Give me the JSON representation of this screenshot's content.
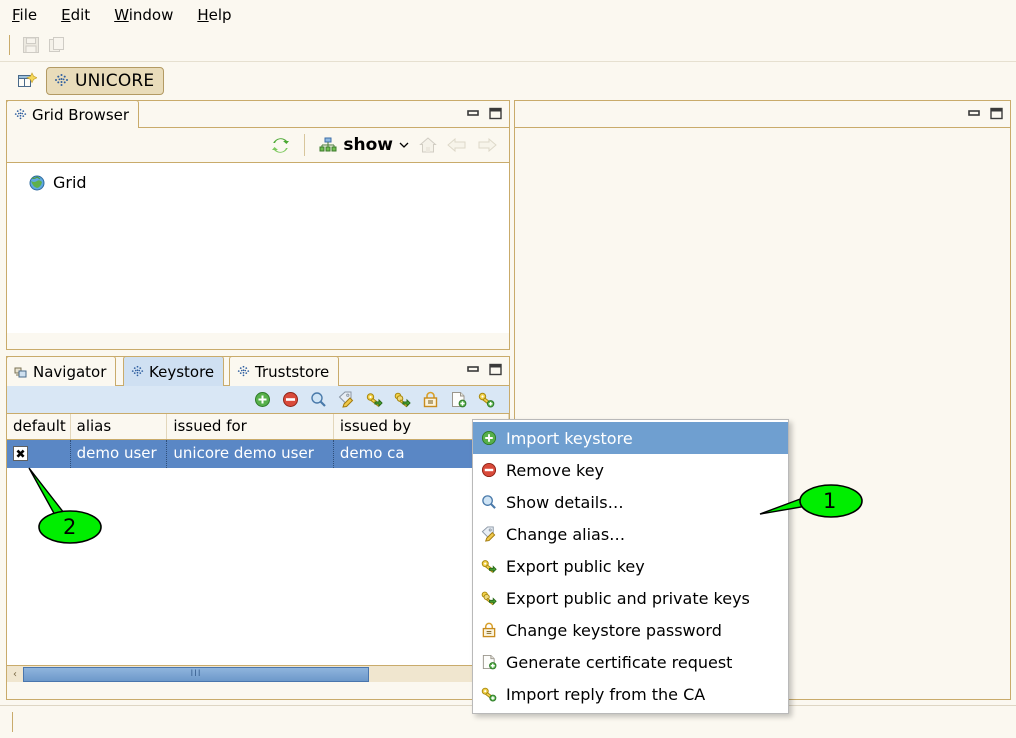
{
  "menubar": {
    "items": [
      {
        "mnemonic": "F",
        "rest": "ile"
      },
      {
        "mnemonic": "E",
        "rest": "dit"
      },
      {
        "mnemonic": "W",
        "rest": "indow"
      },
      {
        "mnemonic": "H",
        "rest": "elp"
      }
    ]
  },
  "toolbar": {
    "buttons": [
      {
        "name": "save-icon",
        "enabled": false
      },
      {
        "name": "copy-icon",
        "enabled": false
      }
    ]
  },
  "perspective": {
    "open_icon": "open-perspective-icon",
    "active_label": "UNICORE",
    "active_icon": "unicore-grid-icon"
  },
  "grid_browser": {
    "tab_label": "Grid Browser",
    "tab_icon": "unicore-grid-icon",
    "toolbar": {
      "refresh_icon": "refresh-icon",
      "show_icon": "hierarchy-icon",
      "show_label": "show",
      "show_chevron": "chevron-down-icon",
      "home_icon": "home-icon",
      "back_icon": "arrow-left-icon",
      "forward_icon": "arrow-right-icon"
    },
    "tree": [
      {
        "label": "Grid",
        "icon": "globe-icon"
      }
    ],
    "view_buttons": [
      "minimize-icon",
      "maximize-icon"
    ]
  },
  "right_panel": {
    "view_buttons": [
      "minimize-icon",
      "maximize-icon"
    ]
  },
  "bottom_view": {
    "tabs": [
      {
        "label": "Navigator",
        "icon": "navigator-icon",
        "active": false
      },
      {
        "label": "Keystore",
        "icon": "unicore-grid-icon",
        "active": true
      },
      {
        "label": "Truststore",
        "icon": "unicore-grid-icon",
        "active": false
      }
    ],
    "view_buttons": [
      "minimize-icon",
      "maximize-icon"
    ],
    "toolbar_icons": [
      "import-keystore-icon",
      "remove-key-icon",
      "show-details-icon",
      "change-alias-icon",
      "export-public-key-icon",
      "export-public-private-keys-icon",
      "change-keystore-password-icon",
      "generate-certificate-request-icon",
      "import-reply-from-ca-icon"
    ],
    "table": {
      "columns": [
        "default",
        "alias",
        "issued for",
        "issued by"
      ],
      "rows": [
        {
          "default_checked": true,
          "alias": "demo user",
          "issued_for": "unicore demo user",
          "issued_by": "demo ca",
          "selected": true
        }
      ]
    },
    "scrollbar": {
      "grip": "III",
      "left_arrow": "‹"
    }
  },
  "context_menu": {
    "items": [
      {
        "label": "Import keystore",
        "icon": "import-keystore-icon",
        "selected": true
      },
      {
        "label": "Remove key",
        "icon": "remove-key-icon",
        "selected": false
      },
      {
        "label": "Show details…",
        "icon": "show-details-icon",
        "selected": false
      },
      {
        "label": "Change alias…",
        "icon": "change-alias-icon",
        "selected": false
      },
      {
        "label": "Export public key",
        "icon": "export-public-key-icon",
        "selected": false
      },
      {
        "label": "Export public and private keys",
        "icon": "export-public-private-keys-icon",
        "selected": false
      },
      {
        "label": "Change keystore password",
        "icon": "change-keystore-password-icon",
        "selected": false
      },
      {
        "label": "Generate certificate request",
        "icon": "generate-certificate-request-icon",
        "selected": false
      },
      {
        "label": "Import reply from the CA",
        "icon": "import-reply-from-ca-icon",
        "selected": false
      }
    ]
  },
  "annotations": {
    "color": "#00ee00",
    "callouts": [
      {
        "label": "1",
        "target": "context-menu"
      },
      {
        "label": "2",
        "target": "default-checkbox"
      }
    ]
  },
  "colors": {
    "window_bg": "#fbf8f0",
    "frame_border": "#c9ab6b",
    "selection_blue": "#5a87c5",
    "menu_highlight": "#6f9fd0",
    "active_tab_blue": "#cfe0f2",
    "perspective_tab": "#e9dcba",
    "callout_green": "#00ee00"
  }
}
